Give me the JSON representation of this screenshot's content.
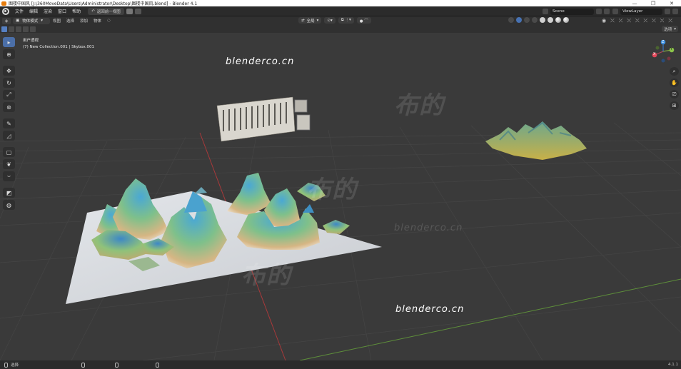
{
  "window": {
    "title": "图楼中国风 [J:\\360MoveData\\Users\\Administrator\\Desktop\\图楼中国风.blend] - Blender 4.1",
    "controls": [
      "—",
      "❐",
      "✕"
    ]
  },
  "menubar": {
    "items": [
      "文件",
      "编辑",
      "渲染",
      "窗口",
      "帮助"
    ],
    "undo_label": "返回前一视图",
    "scene_label": "Scene",
    "viewlayer_label": "ViewLayer"
  },
  "header": {
    "mode_label": "物体模式",
    "menus": [
      "视图",
      "选择",
      "添加",
      "物体"
    ],
    "transform_label": "全局",
    "options_label": "选项"
  },
  "viewport": {
    "view_name": "用户透视",
    "collection_info": "(7) New Collection.001 | Skybox.001",
    "gizmo": {
      "x": "X",
      "y": "Y",
      "z": "Z"
    }
  },
  "watermarks": {
    "en_1": "blenderco.cn",
    "en_2": "blenderco.cn",
    "en_3": "blenderco.cn",
    "cn_1": "布的",
    "cn_2": "布的",
    "cn_3": "布的"
  },
  "statusbar": {
    "select_label": "选择",
    "version": "4.1.1"
  },
  "colors": {
    "accent": "#4b6fa8",
    "grid_bg": "#3a3a3a",
    "axis_x": "#c0393b",
    "axis_y": "#6fa043",
    "gizmo_x": "#e4475a",
    "gizmo_y": "#8bc34a",
    "gizmo_z": "#3d8fe0"
  }
}
